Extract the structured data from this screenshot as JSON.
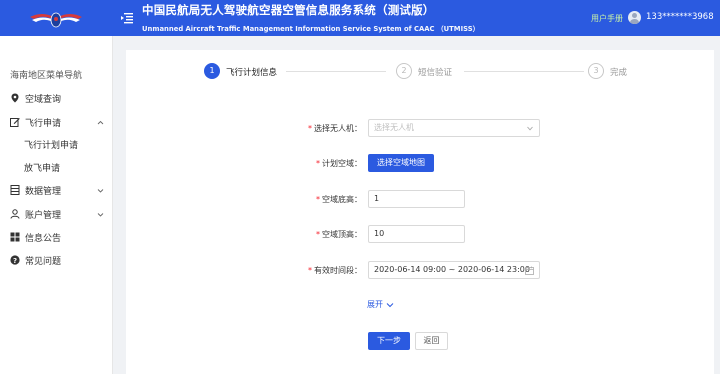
{
  "header": {
    "title_cn": "中国民航局无人驾驶航空器空管信息服务系统（测试版）",
    "title_en": "Unmanned Aircraft Traffic Management Information Service System of CAAC （UTMISS）",
    "user_manual": "用户手册",
    "phone": "133*******3968",
    "bg_color": "#2b5ae0"
  },
  "sidebar": {
    "title": "海南地区菜单导航",
    "items": [
      {
        "label": "空域查询",
        "icon": "location-pin-icon"
      },
      {
        "label": "飞行申请",
        "icon": "edit-icon",
        "expanded": true,
        "children": [
          "飞行计划申请",
          "放飞申请"
        ]
      },
      {
        "label": "数据管理",
        "icon": "data-icon"
      },
      {
        "label": "账户管理",
        "icon": "user-icon"
      },
      {
        "label": "信息公告",
        "icon": "grid-icon"
      },
      {
        "label": "常见问题",
        "icon": "question-icon"
      }
    ]
  },
  "steps": [
    {
      "num": "1",
      "label": "飞行计划信息",
      "status": "active"
    },
    {
      "num": "2",
      "label": "短信验证",
      "status": "inactive"
    },
    {
      "num": "3",
      "label": "完成",
      "status": "inactive"
    }
  ],
  "form": {
    "drone_label": "选择无人机：",
    "drone_placeholder": "选择无人机",
    "airspace_label": "计划空域：",
    "airspace_button": "选择空域地图",
    "bottom_label": "空域底高：",
    "bottom_value": "1",
    "top_label": "空域顶高：",
    "top_value": "10",
    "time_label": "有效时间段：",
    "time_value": "2020-06-14 09:00 ~ 2020-06-14 23:00",
    "expand_label": "展开",
    "next_button": "下一步",
    "back_button": "返回"
  }
}
